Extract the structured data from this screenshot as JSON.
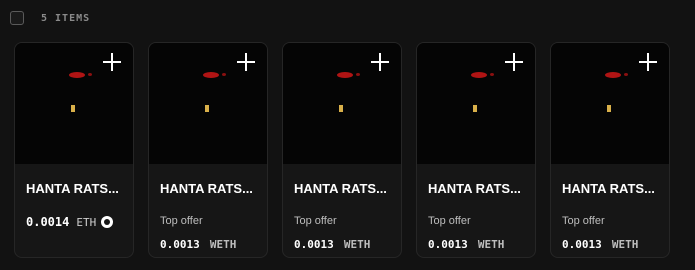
{
  "header": {
    "item_count": "5 ITEMS"
  },
  "cards": [
    {
      "name": "HANTA RATS...",
      "price": "0.0014",
      "currency": "ETH",
      "currency_icon": "eth-icon"
    },
    {
      "name": "HANTA RATS...",
      "offer_label": "Top offer",
      "offer_price": "0.0013",
      "offer_currency": "WETH"
    },
    {
      "name": "HANTA RATS...",
      "offer_label": "Top offer",
      "offer_price": "0.0013",
      "offer_currency": "WETH"
    },
    {
      "name": "HANTA RATS...",
      "offer_label": "Top offer",
      "offer_price": "0.0013",
      "offer_currency": "WETH"
    },
    {
      "name": "HANTA RATS...",
      "offer_label": "Top offer",
      "offer_price": "0.0013",
      "offer_currency": "WETH"
    }
  ]
}
